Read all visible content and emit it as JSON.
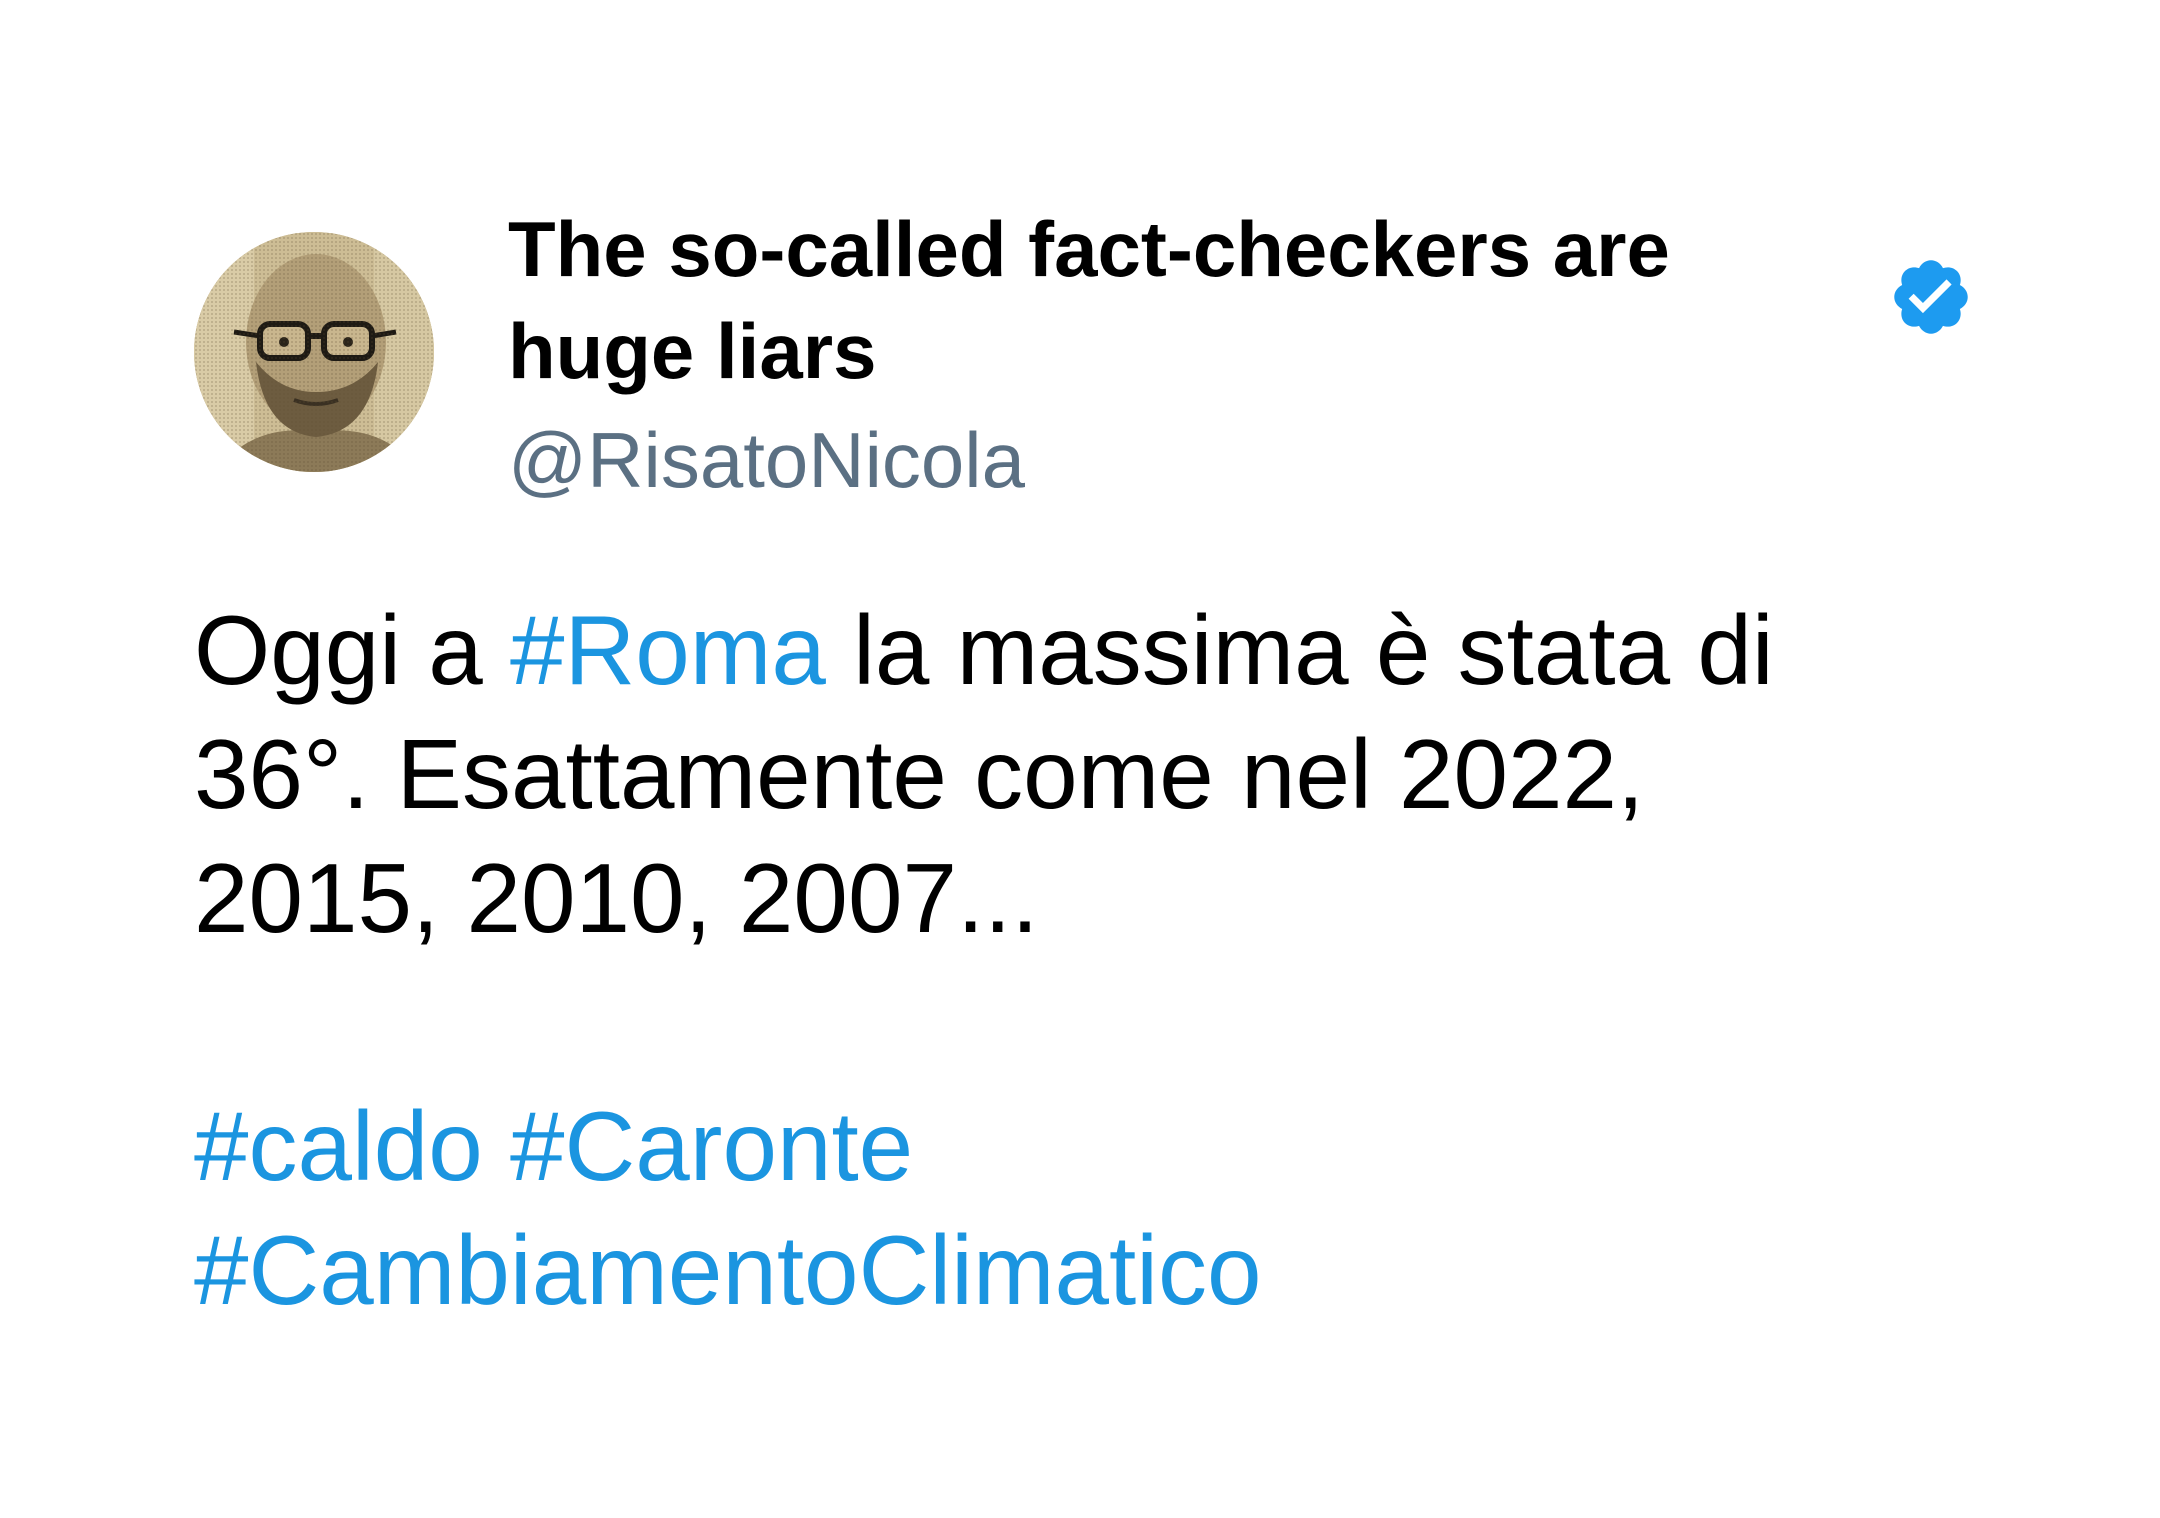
{
  "author": {
    "display_name_line1": "The so-called fact-checkers are",
    "display_name_line2": "huge liars",
    "handle": "@RisatoNicola",
    "verified_icon": "verified-badge-icon",
    "avatar_icon": "profile-photo"
  },
  "tweet": {
    "line1_before": "Oggi a ",
    "line1_hashtag": "#Roma",
    "line1_after": " la massima è stata di",
    "line2": "36°. Esattamente come nel 2022,",
    "line3": "2015, 2010, 2007...",
    "hashtag_caldo": "#caldo",
    "hashtag_caronte": "#Caronte",
    "hashtag_cambiamento": "#CambiamentoClimatico"
  },
  "colors": {
    "hashtag": "#1b95e0",
    "handle": "#5b7083",
    "verified": "#1d9bf0",
    "text": "#000000",
    "background": "#ffffff"
  }
}
